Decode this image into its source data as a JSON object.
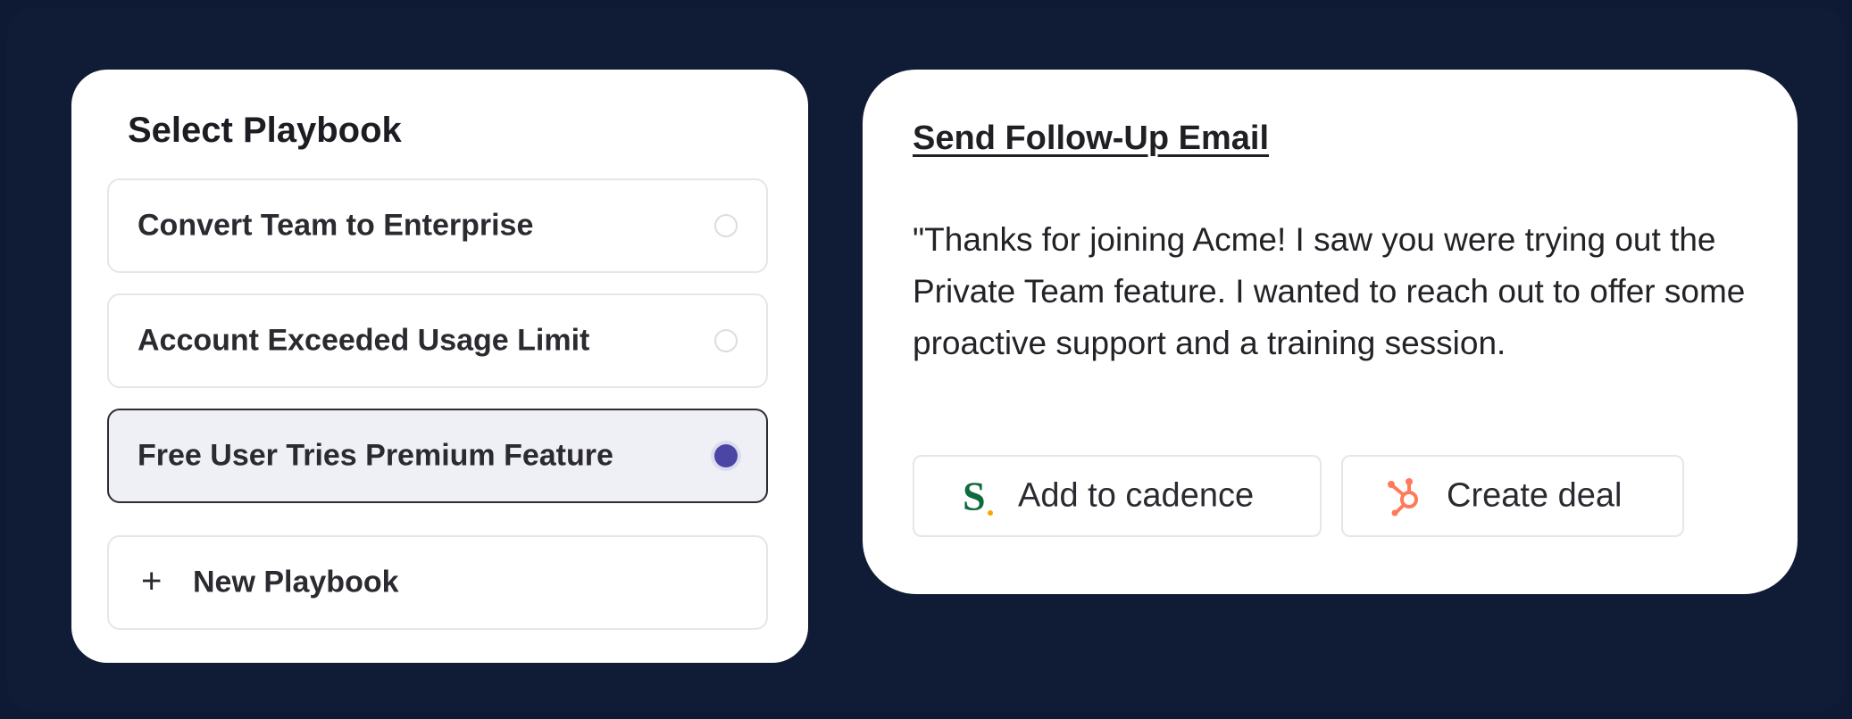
{
  "playbook_panel": {
    "title": "Select Playbook",
    "options": [
      {
        "label": "Convert Team to Enterprise",
        "selected": false
      },
      {
        "label": "Account Exceeded Usage Limit",
        "selected": false
      },
      {
        "label": "Free User Tries Premium Feature",
        "selected": true
      }
    ],
    "new_button": {
      "icon": "plus-icon",
      "label": "New Playbook"
    }
  },
  "email_panel": {
    "title": "Send Follow-Up Email",
    "body": "\"Thanks for joining Acme! I saw you were trying out the Private Team feature. I wanted to reach out to offer some proactive support and a training session.",
    "actions": [
      {
        "icon": "salesloft-s-icon",
        "label": "Add to cadence",
        "icon_color": "#0f6b3e"
      },
      {
        "icon": "hubspot-sprocket-icon",
        "label": "Create deal",
        "icon_color": "#ff7a59"
      }
    ]
  },
  "colors": {
    "background": "#101b36",
    "card": "#ffffff",
    "selected_option_bg": "#eef0f6",
    "radio_selected": "#4b46a6"
  }
}
